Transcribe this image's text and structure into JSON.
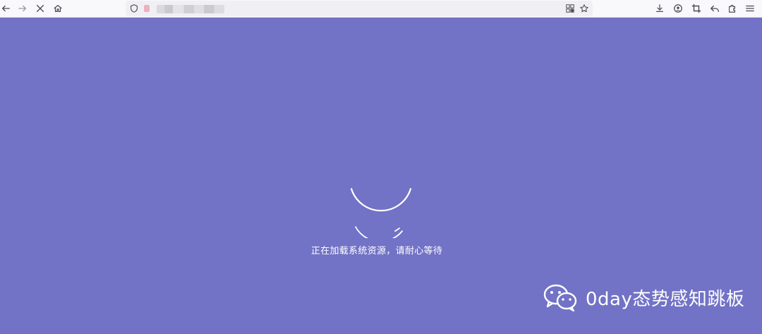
{
  "browser": {
    "url_blurred": true,
    "nav": [
      "back-icon",
      "forward-icon",
      "stop-icon",
      "home-icon"
    ],
    "right_icons": [
      "download-icon",
      "account-icon",
      "screenshot-icon",
      "undo-icon",
      "extensions-icon",
      "menu-icon"
    ]
  },
  "page": {
    "background": "#7272c6",
    "loading_text": "正在加载系统资源，请耐心等待"
  },
  "watermark": {
    "text": "0day态势感知跳板"
  }
}
